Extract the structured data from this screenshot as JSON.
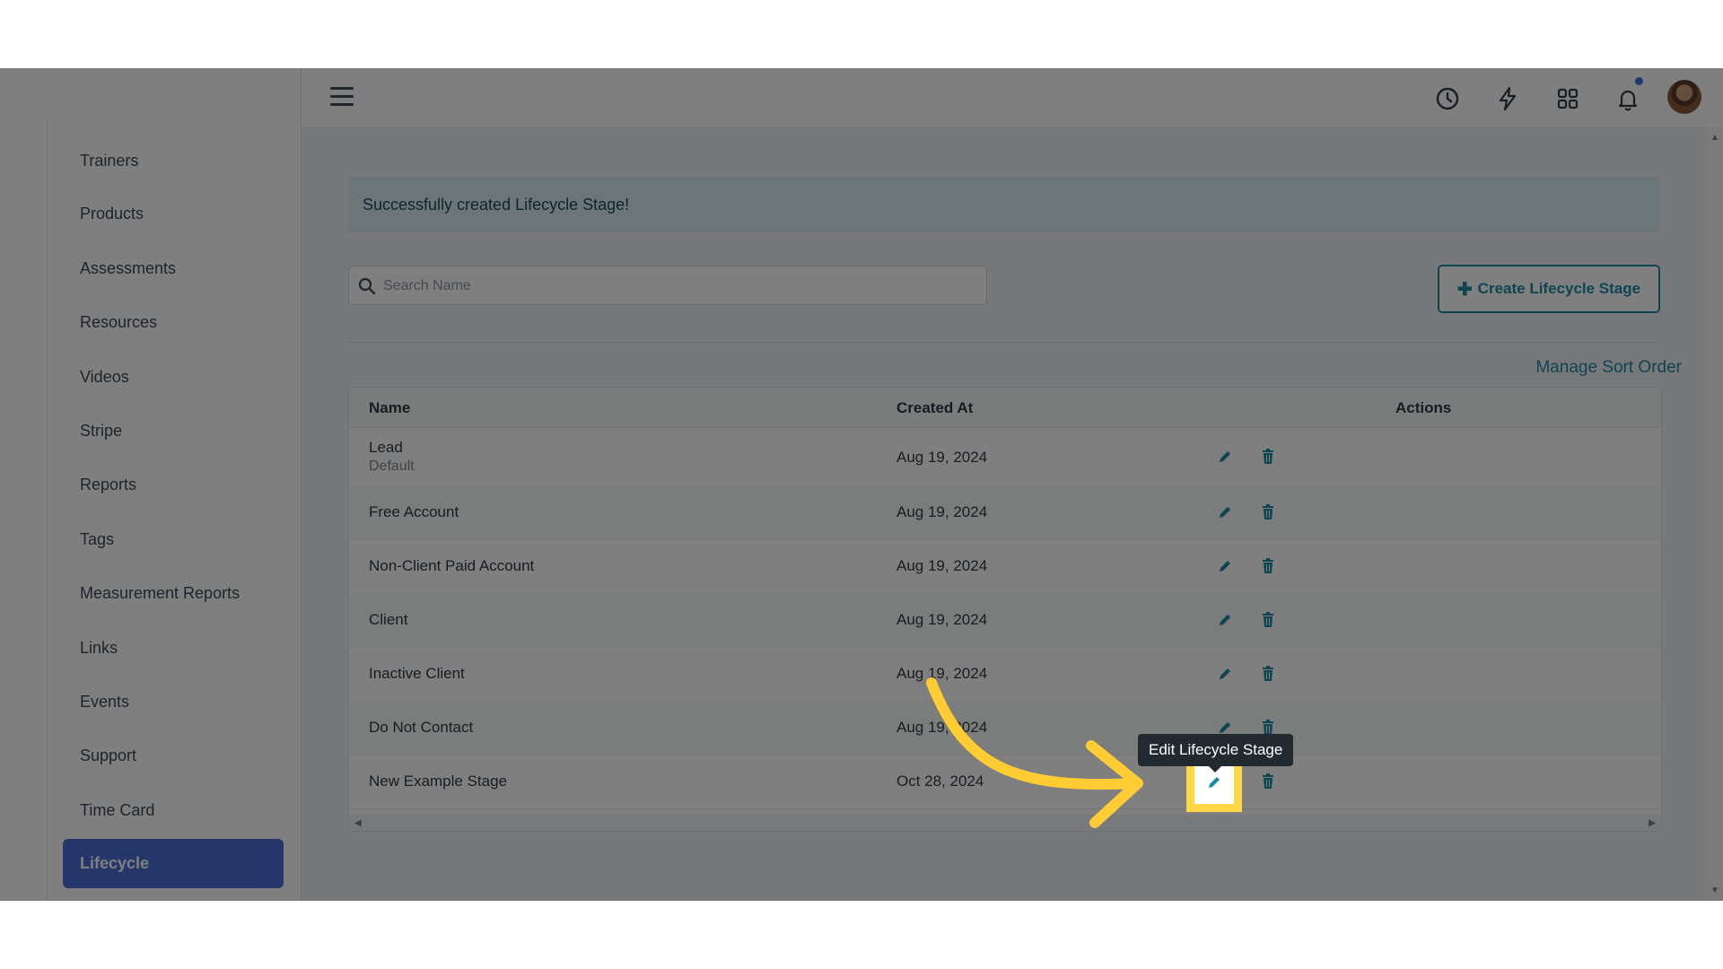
{
  "sidebar": {
    "items": [
      {
        "label": "Trainers"
      },
      {
        "label": "Products"
      },
      {
        "label": "Assessments"
      },
      {
        "label": "Resources"
      },
      {
        "label": "Videos"
      },
      {
        "label": "Stripe"
      },
      {
        "label": "Reports"
      },
      {
        "label": "Tags"
      },
      {
        "label": "Measurement Reports"
      },
      {
        "label": "Links"
      },
      {
        "label": "Events"
      },
      {
        "label": "Support"
      },
      {
        "label": "Time Card"
      },
      {
        "label": "Lifecycle"
      }
    ],
    "active": "Lifecycle"
  },
  "topbar": {
    "icons": [
      "menu-icon",
      "clock-icon",
      "lightning-icon",
      "grid-icon",
      "bell-icon",
      "user-avatar"
    ]
  },
  "alert": {
    "message": "Successfully created Lifecycle Stage!"
  },
  "search": {
    "placeholder": "Search Name",
    "value": ""
  },
  "buttons": {
    "create": "Create Lifecycle Stage",
    "manage_sort": "Manage Sort Order"
  },
  "table": {
    "headers": {
      "name": "Name",
      "created_at": "Created At",
      "actions": "Actions"
    },
    "rows": [
      {
        "name": "Lead",
        "sub": "Default",
        "created_at": "Aug 19, 2024"
      },
      {
        "name": "Free Account",
        "created_at": "Aug 19, 2024"
      },
      {
        "name": "Non-Client Paid Account",
        "created_at": "Aug 19, 2024"
      },
      {
        "name": "Client",
        "created_at": "Aug 19, 2024"
      },
      {
        "name": "Inactive Client",
        "created_at": "Aug 19, 2024"
      },
      {
        "name": "Do Not Contact",
        "created_at": "Aug 19, 2024"
      },
      {
        "name": "New Example Stage",
        "created_at": "Oct 28, 2024"
      }
    ]
  },
  "tooltip": {
    "text": "Edit Lifecycle Stage"
  },
  "colors": {
    "accent": "#1b8aa4",
    "active_nav": "#4a6fd4",
    "highlight": "#ffd84a",
    "arrow": "#ffcc33"
  }
}
